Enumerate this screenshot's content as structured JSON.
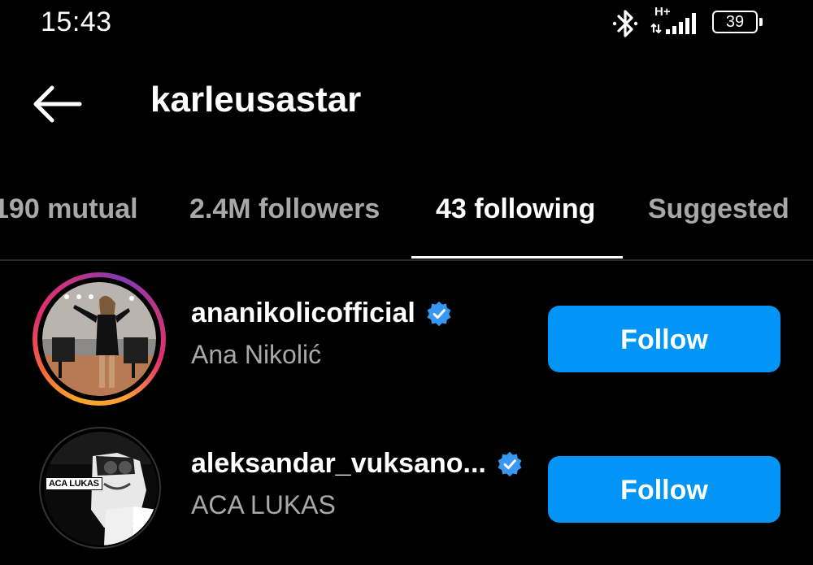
{
  "status_bar": {
    "time": "15:43",
    "network": "H+",
    "battery": "39"
  },
  "header": {
    "title": "karleusastar"
  },
  "tabs": [
    {
      "label": "190 mutual"
    },
    {
      "label": "2.4M followers"
    },
    {
      "label": "43 following",
      "active": true
    },
    {
      "label": "Suggested"
    }
  ],
  "rows": [
    {
      "username": "ananikolicofficial",
      "full_name": "Ana Nikolić",
      "verified": true,
      "has_story": true,
      "button_label": "Follow"
    },
    {
      "username": "aleksandar_vuksano...",
      "full_name": "ACA LUKAS",
      "verified": true,
      "has_story": false,
      "avatar_logo_text": "ACA LUKAS",
      "button_label": "Follow"
    }
  ],
  "colors": {
    "background": "#000000",
    "primary_button": "#0095f6",
    "verified_badge": "#3897f0",
    "secondary_text": "#a8a8a8"
  },
  "icons": {
    "back": "arrow-left-icon",
    "bluetooth": "bluetooth-icon",
    "signal": "signal-bars-icon",
    "battery": "battery-icon",
    "verified": "verified-badge-icon"
  }
}
